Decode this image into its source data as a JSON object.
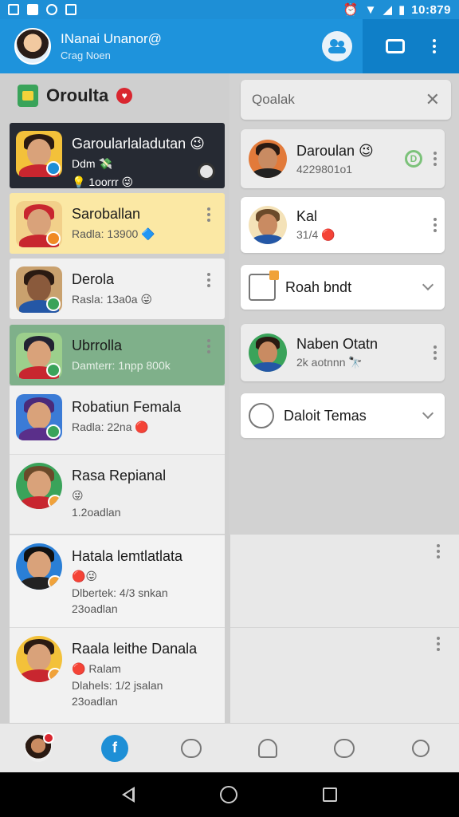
{
  "status_bar": {
    "time": "10:879"
  },
  "header": {
    "title": "INanai Unanor@",
    "subtitle": "Crag Noen"
  },
  "left": {
    "group_title": "Oroulta",
    "chats": [
      {
        "name": "Garoularlaladutan 😉",
        "line1": "Ddm 💸",
        "line2": "💡 1oorrr 😜"
      },
      {
        "name": "Saroballan",
        "line1": "Radla: 13900 🔷"
      },
      {
        "name": "Derola",
        "line1": "Rasla: 13a0a 😜"
      },
      {
        "name": "Ubrrolla",
        "line1": "Damterr: 1npp 800k"
      },
      {
        "name": "Robatiun Femala",
        "line1": "Radla: 22na 🔴"
      },
      {
        "name": "Rasa Repianal",
        "line1": "😜",
        "line2": "1.2oadlan"
      },
      {
        "name": "Hatala lemtlatlata",
        "line1": "🔴😜",
        "line2": "Dlbertek: 4/3 snkan",
        "line3": "23oadlan"
      },
      {
        "name": "Raala leithe Danala",
        "line1": "🔴 Ralam",
        "line2": "Dlahels: 1/2 jsalan",
        "line3": "23oadlan"
      }
    ]
  },
  "right": {
    "search_placeholder": "Qoalak",
    "close_glyph": "✕",
    "cards": [
      {
        "name": "Daroulan 😉",
        "line": "4229801o1",
        "chip": "D"
      },
      {
        "name": "Kal",
        "line": "31/4 🔴"
      },
      {
        "name": "Roah bndt"
      },
      {
        "name": "Naben Otatn",
        "line": "2k aotnnn 🔭"
      },
      {
        "name": "Daloit Temas"
      }
    ]
  },
  "bottom_nav": {
    "home_glyph": "f"
  }
}
